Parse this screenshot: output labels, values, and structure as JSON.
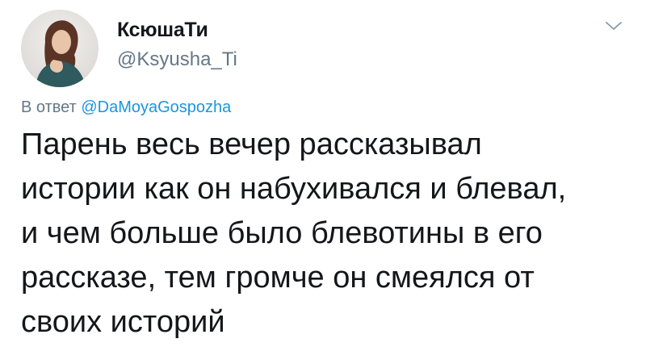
{
  "tweet": {
    "author": {
      "display_name": "КсюшаТи",
      "handle": "@Ksyusha_Ti",
      "avatar_icon": "user-photo-avatar"
    },
    "menu_icon": "chevron-down-icon",
    "reply": {
      "prefix": "В ответ",
      "mention": "@DaMoyaGospozha"
    },
    "text_lines": [
      "Парень весь вечер рассказывал",
      "истории как он набухивался и блевал,",
      "и чем больше было блевотины в его",
      "рассказе, тем громче он смеялся от",
      "своих историй"
    ]
  },
  "colors": {
    "text": "#14171a",
    "secondary": "#657786",
    "link": "#1b95e0"
  }
}
